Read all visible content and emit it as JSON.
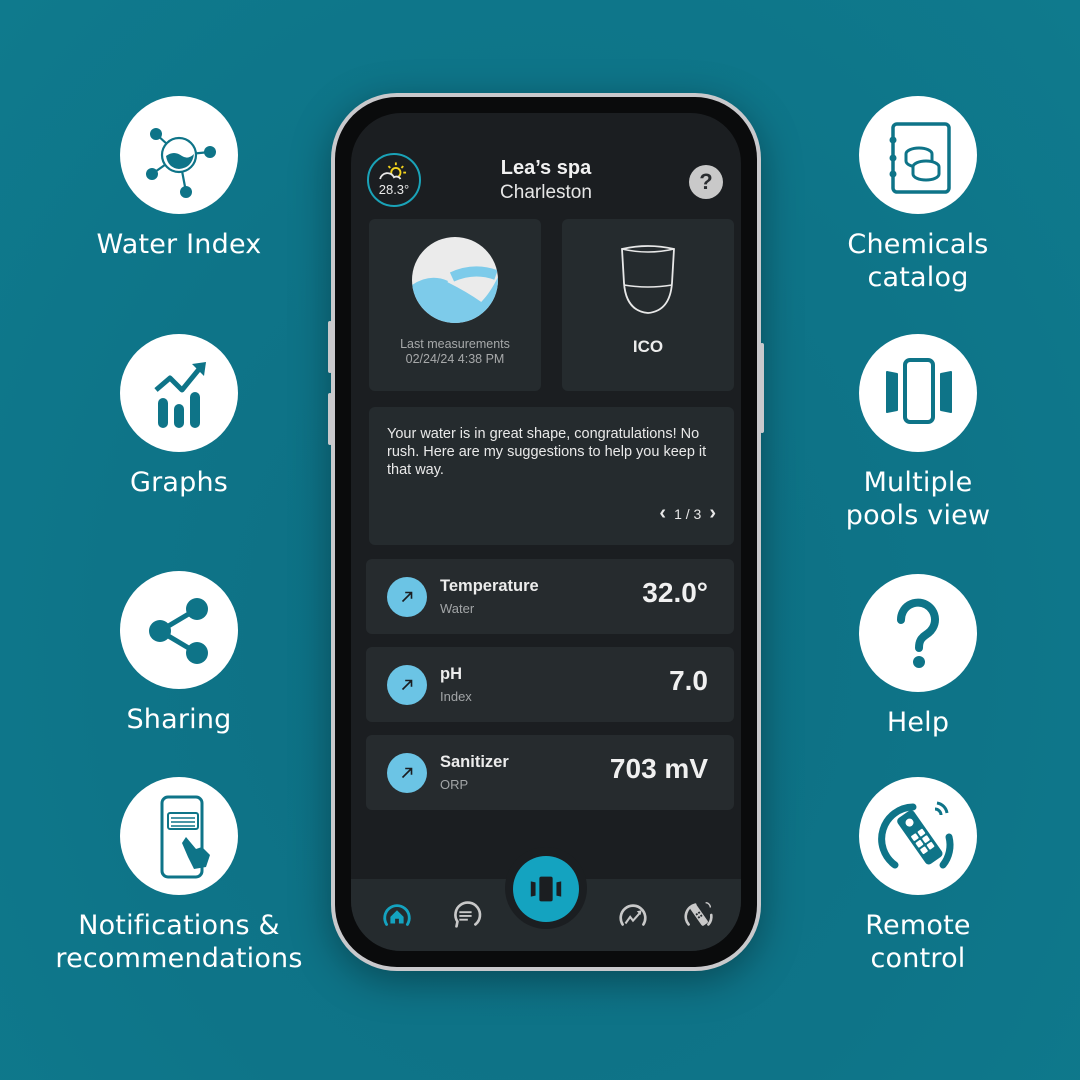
{
  "features": {
    "left": [
      {
        "label": "Water Index",
        "icon": "water-index-icon"
      },
      {
        "label": "Graphs",
        "icon": "graphs-icon"
      },
      {
        "label": "Sharing",
        "icon": "share-icon"
      },
      {
        "label": "Notifications &\nrecommendations",
        "icon": "notification-icon"
      }
    ],
    "right": [
      {
        "label": "Chemicals\ncatalog",
        "icon": "chemicals-catalog-icon"
      },
      {
        "label": "Multiple\npools view",
        "icon": "multiple-pools-icon"
      },
      {
        "label": "Help",
        "icon": "help-icon"
      },
      {
        "label": "Remote\ncontrol",
        "icon": "remote-control-icon"
      }
    ]
  },
  "app": {
    "weather": {
      "temp": "28.3°",
      "icon": "partly-sunny-icon"
    },
    "title": "Lea’s spa",
    "subtitle": "Charleston",
    "help_label": "?",
    "measurements": {
      "label": "Last measurements",
      "timestamp": "02/24/24 4:38 PM"
    },
    "device": {
      "label": "ICO"
    },
    "message": {
      "text": "Your water is in great shape, congratulations! No rush. Here are my suggestions to help you keep it that way.",
      "pager": "1 / 3",
      "prev": "‹",
      "next": "›"
    },
    "metrics": [
      {
        "name": "Temperature",
        "sub": "Water",
        "value": "32.0°",
        "trend": "up-right"
      },
      {
        "name": "pH",
        "sub": "Index",
        "value": "7.0",
        "trend": "up-right"
      },
      {
        "name": "Sanitizer",
        "sub": "ORP",
        "value": "703 mV",
        "trend": "up-right"
      }
    ],
    "nav": [
      {
        "id": "home",
        "active": true
      },
      {
        "id": "messages",
        "active": false
      },
      {
        "id": "pools",
        "active": false
      },
      {
        "id": "graphs",
        "active": false
      },
      {
        "id": "remote",
        "active": false
      }
    ]
  },
  "colors": {
    "background": "#0e7488",
    "accent": "#14a3c0",
    "trend_icon": "#6bc4e5",
    "screen": "#1b1e21",
    "card": "#252b2e"
  }
}
